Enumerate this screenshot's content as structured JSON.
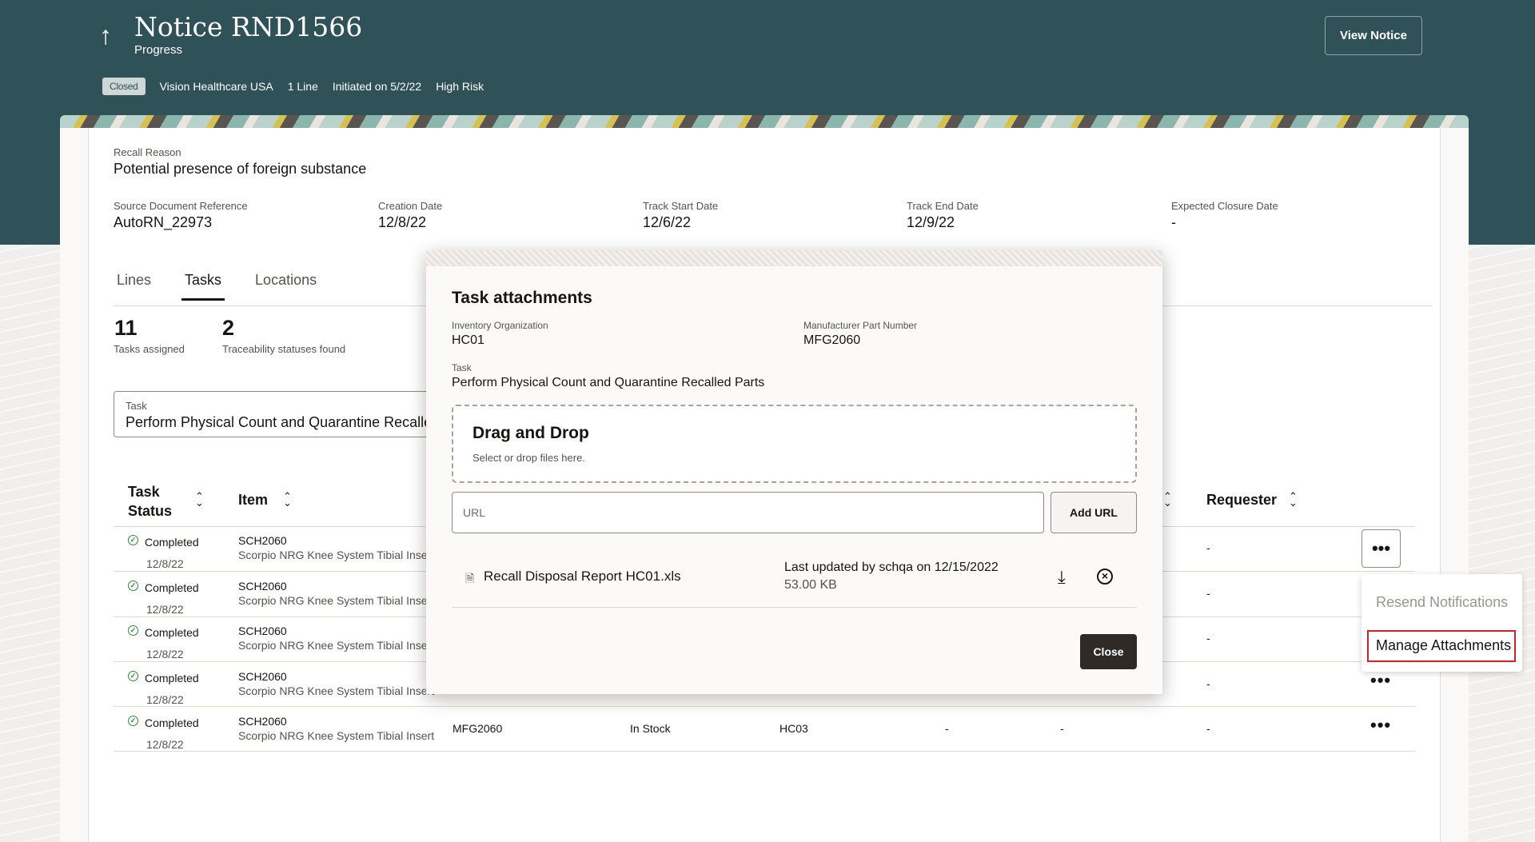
{
  "header": {
    "title": "Notice RND1566",
    "subtitle": "Progress",
    "view_notice_label": "View Notice",
    "status_badge": "Closed",
    "meta": [
      "Vision Healthcare USA",
      "1 Line",
      "Initiated on 5/2/22",
      "High Risk"
    ]
  },
  "details": {
    "recall_reason_label": "Recall Reason",
    "recall_reason": "Potential presence of foreign substance",
    "source_doc_label": "Source Document Reference",
    "source_doc": "AutoRN_22973",
    "creation_date_label": "Creation Date",
    "creation_date": "12/8/22",
    "track_start_label": "Track Start Date",
    "track_start": "12/6/22",
    "track_end_label": "Track End Date",
    "track_end": "12/9/22",
    "expected_closure_label": "Expected Closure Date",
    "expected_closure": "-"
  },
  "tabs": [
    "Lines",
    "Tasks",
    "Locations"
  ],
  "stats": {
    "tasks_assigned_count": "11",
    "tasks_assigned_label": "Tasks assigned",
    "traceability_count": "2",
    "traceability_label": "Traceability statuses found"
  },
  "task_filter": {
    "label": "Task",
    "value": "Perform Physical Count and Quarantine Recalled Parts"
  },
  "table": {
    "headers": {
      "task_status_line1": "Task",
      "task_status_line2": "Status",
      "item": "Item",
      "requester": "Requester"
    },
    "rows": [
      {
        "status": "Completed",
        "date": "12/8/22",
        "item": "SCH2060",
        "item_desc": "Scorpio NRG Knee System Tibial Insert",
        "requester": "-"
      },
      {
        "status": "Completed",
        "date": "12/8/22",
        "item": "SCH2060",
        "item_desc": "Scorpio NRG Knee System Tibial Insert",
        "requester": "-"
      },
      {
        "status": "Completed",
        "date": "12/8/22",
        "item": "SCH2060",
        "item_desc": "Scorpio NRG Knee System Tibial Insert",
        "requester": "-"
      },
      {
        "status": "Completed",
        "date": "12/8/22",
        "item": "SCH2060",
        "item_desc": "Scorpio NRG Knee System Tibial Insert",
        "requester": "-"
      },
      {
        "status": "Completed",
        "date": "12/8/22",
        "item": "SCH2060",
        "item_desc": "Scorpio NRG Knee System Tibial Insert",
        "mfg_part": "MFG2060",
        "stock": "In Stock",
        "org": "HC03",
        "c1": "-",
        "c2": "-",
        "requester": "-"
      }
    ]
  },
  "context_menu": {
    "items": [
      "Resend Notifications",
      "Manage Attachments"
    ]
  },
  "modal": {
    "title": "Task attachments",
    "inv_org_label": "Inventory Organization",
    "inv_org": "HC01",
    "mfg_part_label": "Manufacturer Part Number",
    "mfg_part": "MFG2060",
    "task_label": "Task",
    "task": "Perform Physical Count and Quarantine Recalled Parts",
    "dropzone_title": "Drag and Drop",
    "dropzone_sub": "Select or drop files here.",
    "url_placeholder": "URL",
    "add_url_label": "Add URL",
    "file": {
      "name": "Recall Disposal Report HC01.xls",
      "updated": "Last updated by schqa on 12/15/2022",
      "size": "53.00 KB"
    },
    "close_label": "Close"
  },
  "icons": {
    "back": "arrow-up-icon",
    "sort": "sort-icon",
    "check": "check-circle-icon",
    "more": "more-icon",
    "file": "file-icon",
    "download": "download-icon",
    "remove": "remove-circle-icon"
  },
  "colors": {
    "header_bg": "#2f5158",
    "primary_button": "#2f2a26",
    "highlight": "#d61f28",
    "success": "#2b8a3e"
  }
}
